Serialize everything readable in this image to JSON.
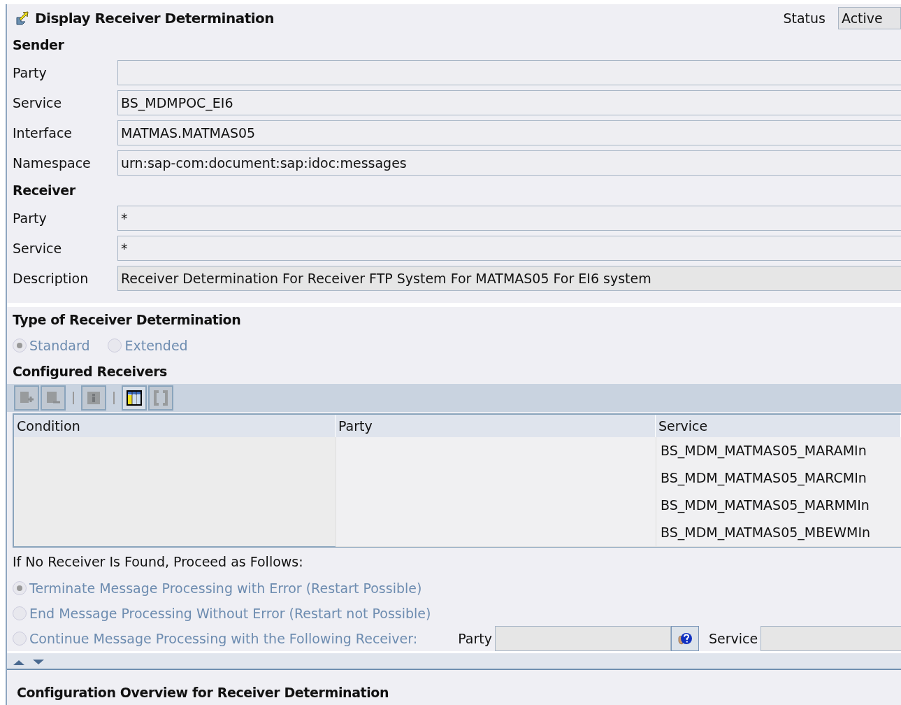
{
  "header": {
    "title": "Display Receiver Determination",
    "status_label": "Status",
    "status_value": "Active"
  },
  "sender": {
    "heading": "Sender",
    "fields": [
      {
        "label": "Party"
      },
      {
        "label": "Service",
        "value": "BS_MDMPOC_EI6"
      },
      {
        "label": "Interface",
        "value": "MATMAS.MATMAS05"
      },
      {
        "label": "Namespace",
        "value": "urn:sap-com:document:sap:idoc:messages"
      }
    ]
  },
  "receiver": {
    "heading": "Receiver",
    "fields": [
      {
        "label": "Party",
        "value": "*"
      },
      {
        "label": "Service",
        "value": "*"
      },
      {
        "label": "Description",
        "value": "Receiver Determination For Receiver FTP System For MATMAS05 For EI6 system"
      }
    ]
  },
  "type": {
    "heading": "Type of Receiver Determination",
    "options": [
      {
        "label": "Standard",
        "selected": true
      },
      {
        "label": "Extended",
        "selected": false
      }
    ]
  },
  "configured": {
    "heading": "Configured Receivers",
    "toolbar": [
      {
        "kind": "add",
        "disabled": true
      },
      {
        "kind": "remove",
        "disabled": true
      },
      {
        "kind": "sep"
      },
      {
        "kind": "info",
        "disabled": true
      },
      {
        "kind": "sep"
      },
      {
        "kind": "columns",
        "disabled": false
      },
      {
        "kind": "brackets",
        "disabled": true
      }
    ],
    "columns": [
      "Condition",
      "Party",
      "Service"
    ],
    "rows": [
      [
        "",
        "",
        "BS_MDM_MATMAS05_MARAMIn"
      ],
      [
        "",
        "",
        "BS_MDM_MATMAS05_MARCMIn"
      ],
      [
        "",
        "",
        "BS_MDM_MATMAS05_MARMMIn"
      ],
      [
        "",
        "",
        "BS_MDM_MATMAS05_MBEWMIn"
      ]
    ]
  },
  "no_receiver": {
    "heading": "If No Receiver Is Found, Proceed as Follows:",
    "options": [
      {
        "label": "Terminate Message Processing with Error (Restart Possible)",
        "selected": true
      },
      {
        "label": "End Message Processing Without Error (Restart not Possible)",
        "selected": false
      },
      {
        "label": "Continue Message Processing with the Following Receiver:",
        "selected": false
      }
    ],
    "party_label": "Party",
    "service_label": "Service"
  },
  "overview": {
    "heading": "Configuration Overview for Receiver Determination"
  }
}
